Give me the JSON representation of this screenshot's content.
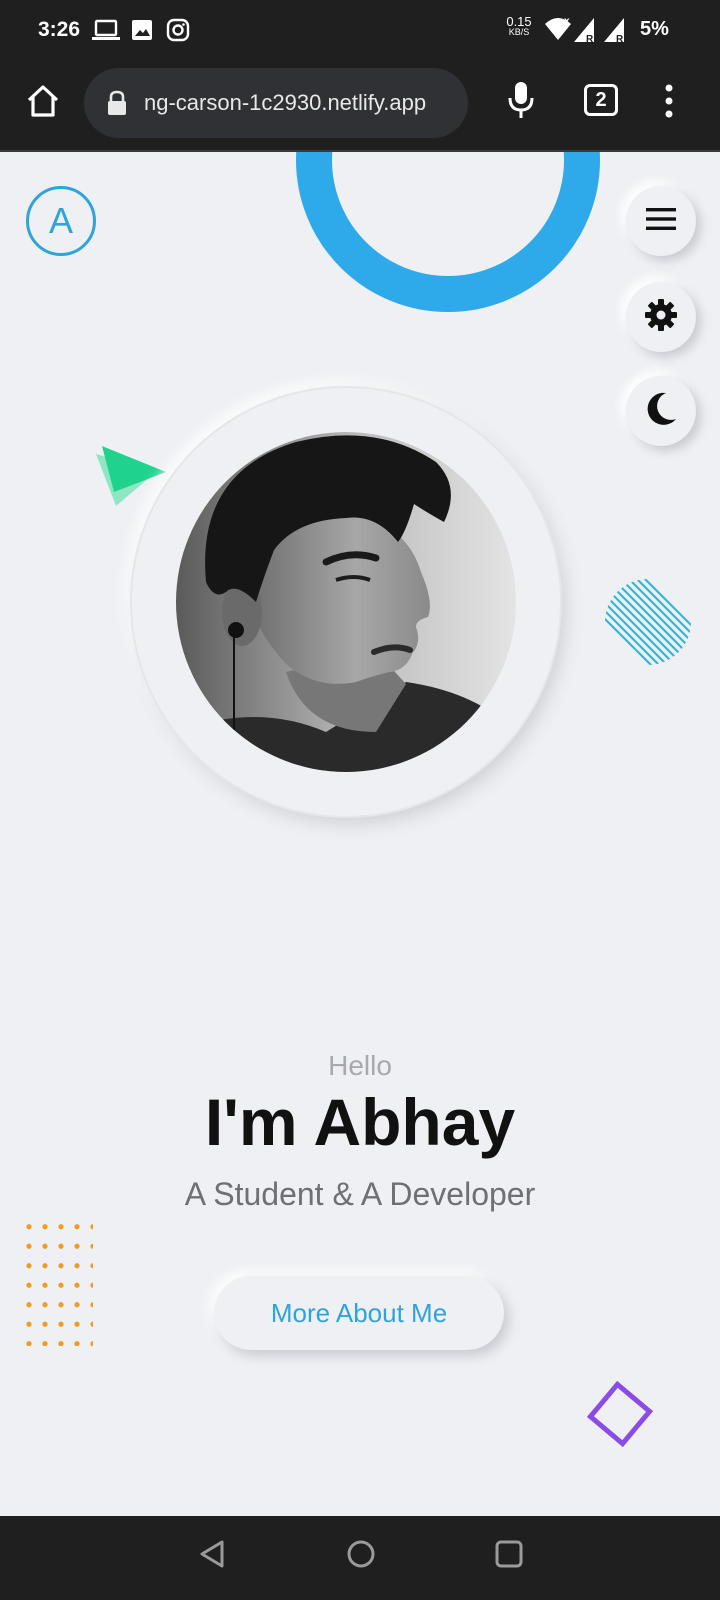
{
  "status_bar": {
    "time": "3:26",
    "notification_icons": [
      "laptop-icon",
      "image-icon",
      "instagram-icon"
    ],
    "network_speed_value": "0.15",
    "network_speed_unit": "KB/S",
    "signal_icons": [
      "wifi-icon",
      "cell-signal-icon",
      "cell-signal-icon"
    ],
    "battery": "5%"
  },
  "browser": {
    "home_icon": "home-icon",
    "lock_icon": "lock-icon",
    "url": "ng-carson-1c2930.netlify.app",
    "mic_icon": "mic-icon",
    "tab_count": "2",
    "menu_icon": "more-vert-icon"
  },
  "page": {
    "logo_letter": "A",
    "side_buttons": [
      "hamburger-icon",
      "gear-icon",
      "moon-icon"
    ],
    "hero": {
      "greeting": "Hello",
      "name": "I'm Abhay",
      "tagline": "A Student & A Developer",
      "cta_label": "More About Me"
    },
    "colors": {
      "accent": "#2fa4dc",
      "ring": "#2ea9ea",
      "triangle": "#1fd38f",
      "stripes": "#35b6d8",
      "dots": "#f39a22",
      "diamond": "#8b4be8",
      "background": "#eef0f4"
    }
  },
  "nav_bar": {
    "buttons": [
      "back-icon",
      "home-circle-icon",
      "recents-icon"
    ]
  }
}
